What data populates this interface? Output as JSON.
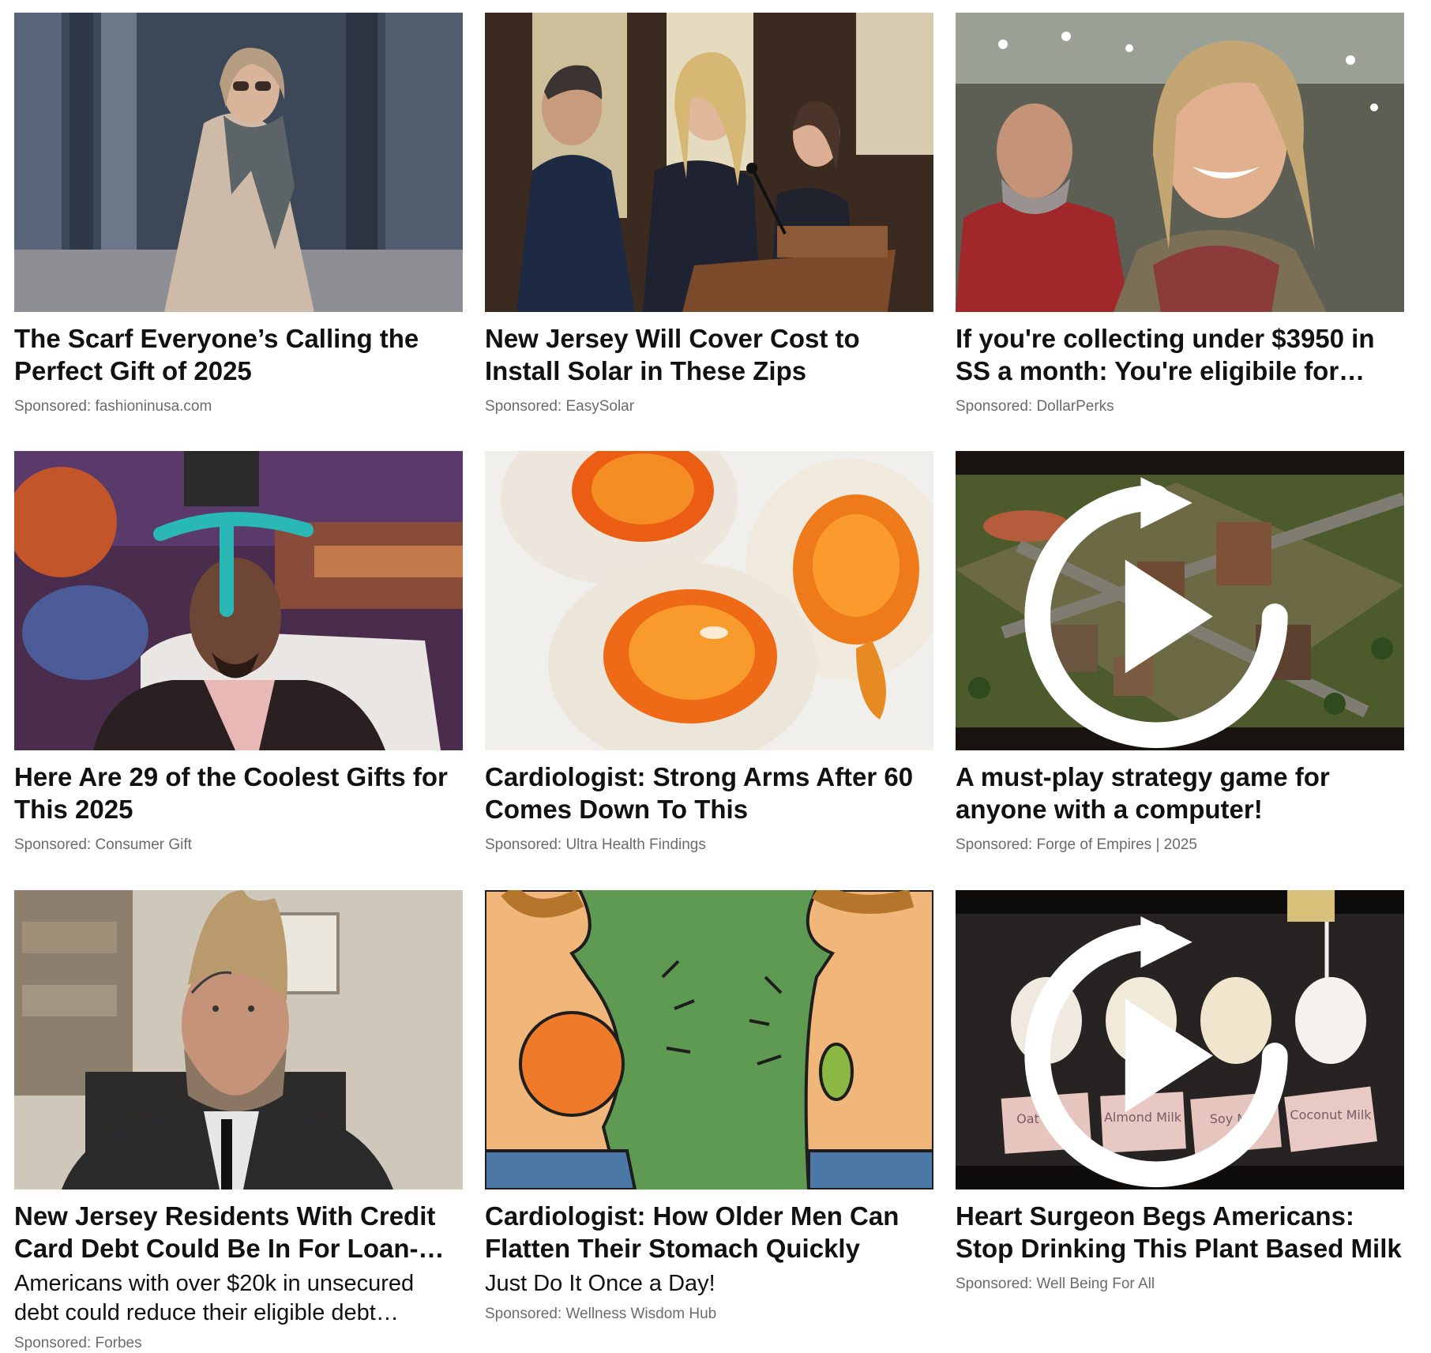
{
  "cards": [
    {
      "title": "The Scarf Everyone’s Calling the Perfect Gift of 2025",
      "sponsor": "Sponsored: fashioninusa.com",
      "description": ""
    },
    {
      "title": "New Jersey Will Cover Cost to Install Solar in These Zips",
      "sponsor": "Sponsored: EasySolar",
      "description": ""
    },
    {
      "title": "If you're collecting under $3950 in SS a month: You're eligibile for…",
      "sponsor": "Sponsored: DollarPerks",
      "description": ""
    },
    {
      "title": "Here Are 29 of the Coolest Gifts for This 2025",
      "sponsor": "Sponsored: Consumer Gift",
      "description": ""
    },
    {
      "title": "Cardiologist: Strong Arms After 60 Comes Down To This",
      "sponsor": "Sponsored: Ultra Health Findings",
      "description": ""
    },
    {
      "title": "A must-play strategy game for anyone with a computer!",
      "sponsor": "Sponsored: Forge of Empires | 2025",
      "description": ""
    },
    {
      "title": "New Jersey Residents With Credit Card Debt Could Be In For Loan-…",
      "sponsor": "Sponsored: Forbes",
      "description": "Americans with over $20k in unsecured debt could reduce their eligible debt…"
    },
    {
      "title": "Cardiologist: How Older Men Can Flatten Their Stomach Quickly",
      "sponsor": "Sponsored: Wellness Wisdom Hub",
      "description": "Just Do It Once a Day!"
    },
    {
      "title": "Heart Surgeon Begs Americans: Stop Drinking This Plant Based Milk",
      "sponsor": "Sponsored: Well Being For All",
      "description": ""
    }
  ],
  "icons": {
    "video": "replay-play-icon"
  },
  "milk_labels": [
    "Oat Milk",
    "Almond Milk",
    "Soy Milk",
    "Coconut Milk"
  ]
}
